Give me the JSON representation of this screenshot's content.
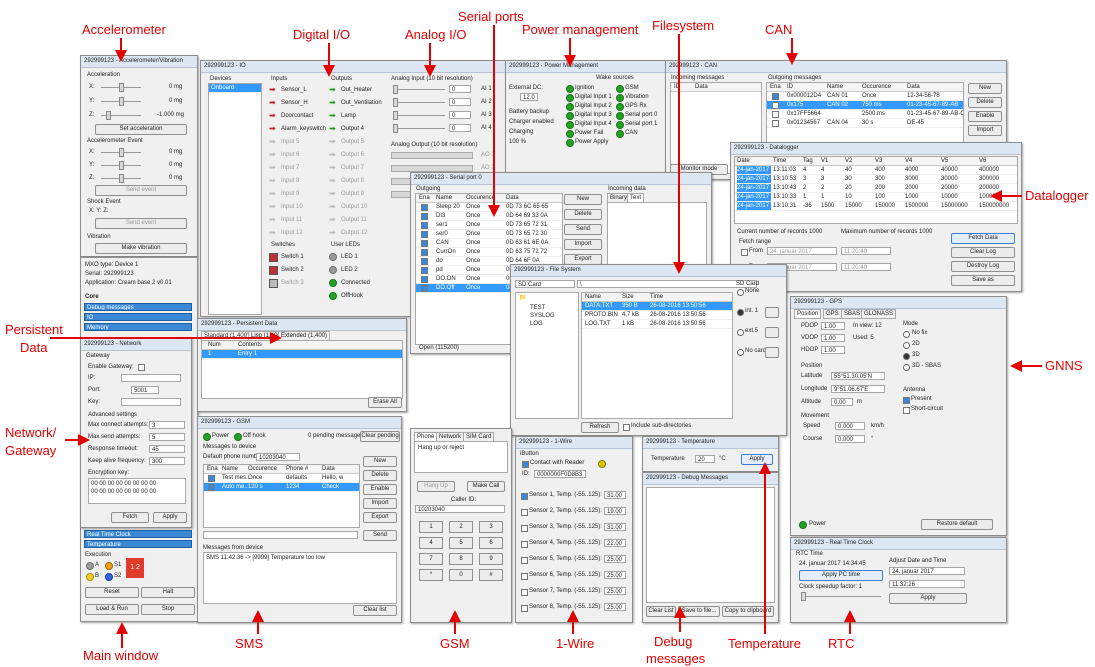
{
  "labels": {
    "accelerometer": "Accelerometer",
    "digital_io": "Digital I/O",
    "analog_io": "Analog I/O",
    "serial_ports": "Serial ports",
    "power_mgmt": "Power management",
    "filesystem": "Filesystem",
    "can": "CAN",
    "datalogger": "Datalogger",
    "persistent_l1": "Persistent",
    "persistent_l2": "Data",
    "gnns": "GNNS",
    "network_l1": "Network/",
    "network_l2": "Gateway",
    "main_window": "Main window",
    "sms": "SMS",
    "gsm": "GSM",
    "one_wire": "1-Wire",
    "debug_l1": "Debug",
    "debug_l2": "messages",
    "temperature": "Temperature",
    "rtc": "RTC"
  },
  "accel": {
    "title": "292999123 - Accelerometer/Vibration",
    "acceleration": "Acceleration",
    "x": "X:",
    "y": "Y:",
    "z": "Z:",
    "xv": "0 mg",
    "yv": "0 mg",
    "zv": "-1.000 mg",
    "set_btn": "Set acceleration",
    "event": "Accelerometer Event",
    "ex": "0 mg",
    "ey": "0 mg",
    "ez": "0 mg",
    "send_event": "Send event",
    "shock": "Shock Event",
    "shock_axes": "X:  Y:  Z:",
    "send_event2": "Send event",
    "vibration": "Vibration",
    "make_vib": "Make vibration"
  },
  "io": {
    "title": "292999123 - IO",
    "devices": "Devices",
    "onboard": "Onboard",
    "inputs": "Inputs",
    "outputs": "Outputs",
    "input_items": [
      "Sensor_L",
      "Sensor_H",
      "Doorcontact",
      "Alarm_keyswitch",
      "Input 5",
      "Input 6",
      "Input 7",
      "Input 8",
      "Input 9",
      "Input 10",
      "Input 11",
      "Input 12"
    ],
    "output_items": [
      "Out_Heater",
      "Out_Ventilation",
      "Lamp",
      "Output 4",
      "Output 5",
      "Output 6",
      "Output 7",
      "Output 8",
      "Output 9",
      "Output 10",
      "Output 11",
      "Output 12"
    ],
    "switches": "Switches",
    "switch_items": [
      "Switch 1",
      "Switch 2",
      "Switch 3"
    ],
    "user_leds": "User LEDs",
    "led_items": [
      "LED 1",
      "LED 2",
      "Connected",
      "OffHook"
    ],
    "analog_in": "Analog Input (10 bit resolution)",
    "ai_labels": [
      "AI 1",
      "AI 2",
      "AI 3",
      "AI 4"
    ],
    "ai_value": "0",
    "analog_out": "Analog Output (10 bit resolution)",
    "ao_labels": [
      "AO 1",
      "AO 2",
      "AO 3",
      "AO 4"
    ]
  },
  "power": {
    "title": "292999123 - Power Management",
    "wake": "Wake sources",
    "ext_dc": "External DC:",
    "voltage": "12.0",
    "battery": "Battery backup",
    "charger": "Charger enabled",
    "charging": "Charging",
    "pct": "100 %",
    "wake_items": [
      "Ignition",
      "Digital Input 1",
      "Digital Input 2",
      "Digital Input 3",
      "Digital Input 4",
      "Power Fail",
      "Power Apply"
    ],
    "wake_items2": [
      "GSM",
      "Vibration",
      "GPS Rx",
      "Serial port 0",
      "Serial port 1",
      "CAN"
    ]
  },
  "can": {
    "title": "292999123 - CAN",
    "incoming": "Incoming messages",
    "id": "ID",
    "data": "Data",
    "outgoing": "Outgoing messages",
    "cols": [
      "Ena",
      "ID",
      "Name",
      "Occurence",
      "Data"
    ],
    "rows": [
      [
        "0x000012D4",
        "CAN 01",
        "Once",
        "12-34-56-78"
      ],
      [
        "0x175",
        "CAN 02",
        "750 ms",
        "01-23-45-67-89-AB"
      ],
      [
        "0x17FF5664",
        "",
        "2500 ms",
        "01-23-45-67-89-AB-CD-EF"
      ],
      [
        "0x01234567",
        "CAN 04",
        "30 s",
        "DE-45"
      ]
    ],
    "btns": [
      "New",
      "Delete",
      "Enable",
      "Import"
    ],
    "monitor": "Monitor mode",
    "clear": "Clear"
  },
  "datalogger": {
    "title": "292999123 - Datalogger",
    "cols": [
      "Date",
      "Time",
      "Tag",
      "V1",
      "V2",
      "V3",
      "V4",
      "V5",
      "V6"
    ],
    "rows": [
      [
        "24-jan-2017",
        "13:11:03",
        "4",
        "4",
        "40",
        "400",
        "4000",
        "40000",
        "400000"
      ],
      [
        "24-jan-2017",
        "13:10:53",
        "3",
        "3",
        "30",
        "300",
        "3000",
        "30000",
        "300000"
      ],
      [
        "24-jan-2017",
        "13:10:43",
        "2",
        "2",
        "20",
        "200",
        "2000",
        "20000",
        "200000"
      ],
      [
        "24-jan-2017",
        "13:10:33",
        "1",
        "1",
        "10",
        "100",
        "1000",
        "10000",
        "100000"
      ],
      [
        "24-jan-2017",
        "13:10:31",
        "-36",
        "1500",
        "15000",
        "150000",
        "1500000",
        "15000000",
        "150000000"
      ]
    ],
    "current": "Current number of records",
    "cur_val": "1000",
    "max": "Maximum number of records",
    "max_val": "1000",
    "fetch_range": "Fetch range",
    "from": "From",
    "to": "To",
    "date": "24.  januar  2017",
    "time": "11:20:40",
    "btns": [
      "Fetch Data",
      "Clear Log",
      "Destroy Log",
      "Save as"
    ]
  },
  "serial": {
    "title": "292999123 - Serial port 0",
    "outgoing": "Outgoing",
    "cols": [
      "Ena",
      "Name",
      "Occurence",
      "Data"
    ],
    "rows": [
      [
        "Sleep 20",
        "Once",
        "0D 73 6C 65 65"
      ],
      [
        "DI3",
        "Once",
        "0D 64 69 33 0A"
      ],
      [
        "ser1",
        "Once",
        "0D 73 65 72 31"
      ],
      [
        "ser0",
        "Once",
        "0D 73 65 72 30"
      ],
      [
        "CAN",
        "Once",
        "0D 63 61 6E 0A"
      ],
      [
        "CurrOn",
        "Once",
        "0D 63 75 72 72"
      ],
      [
        "do",
        "Once",
        "0D 64 6F 0A"
      ],
      [
        "pd",
        "Once",
        "0D 70 64 0A"
      ],
      [
        "DO.ON",
        "Once",
        "0D 64 6F 2E 6F"
      ],
      [
        "DO.Off",
        "Once",
        "0D 64 6F 2E 6F"
      ]
    ],
    "btns": [
      "New",
      "Delete",
      "Send",
      "Import",
      "Export"
    ],
    "incoming": "Incoming data",
    "tab_bin": "Binary",
    "tab_text": "Text",
    "status": "Open (115200)"
  },
  "fs": {
    "title": "292999123 - File System",
    "drive": "SD Card",
    "path": "\\",
    "tree": [
      "TEST",
      "SYSLOG",
      "LOG"
    ],
    "cols": [
      "Name",
      "Size",
      "Time"
    ],
    "rows": [
      [
        "DATA.TXT",
        "350 B",
        "26-08-2016 13:50:56"
      ],
      [
        "PROTO.BIN",
        "4,7 kB",
        "26-08-2016 13:50:56"
      ],
      [
        "LOG.TXT",
        "1 kB",
        "26-08-2016 13:50:56"
      ]
    ],
    "sdcard": "SD Card",
    "radios": [
      "None",
      "int. 1",
      "ext.5",
      "No card"
    ],
    "refresh": "Refresh",
    "include": "Include sub-directories"
  },
  "persist": {
    "title": "292999123 - Persistent Data",
    "tabs": [
      "Standard (1,400)",
      "Lisp (1,400)",
      "Extended (1,400)"
    ],
    "num": "Num",
    "contents": "Contents",
    "row_num": "1",
    "row_val": "Entry 1",
    "erase": "Erase All"
  },
  "gnss": {
    "title": "292999123 - GPS",
    "tabs": [
      "Position",
      "GPS",
      "SBAS",
      "GLONASS"
    ],
    "pdop": "PDOP",
    "pdop_v": "1.00",
    "vdop": "VDOP",
    "vdop_v": "1.00",
    "hdop": "HDOP",
    "hdop_v": "1.00",
    "inview": "In view:",
    "inview_v": "12",
    "used": "Used:",
    "used_v": "5",
    "position": "Position",
    "lat": "Latitude",
    "lat_v": "55°51.30.05'N",
    "lon": "Longitude",
    "lon_v": "9°51.06.67'E",
    "alt": "Altitude",
    "alt_v": "0.00",
    "alt_u": "m",
    "movement": "Movement",
    "speed": "Speed",
    "speed_v": "0.000",
    "speed_u": "km/h",
    "course": "Course",
    "course_v": "0.000",
    "course_u": "°",
    "mode": "Mode",
    "modes": [
      "No fix",
      "2D",
      "3D",
      "3D - SBAS"
    ],
    "antenna": "Antenna",
    "ant": [
      "Present",
      "Short-circuit"
    ],
    "power": "Power",
    "restore": "Restore default"
  },
  "net": {
    "title": "292999123 - Network",
    "gateway": "Gateway",
    "enable": "Enable Gateway:",
    "ip": "IP:",
    "port": "Port:",
    "port_v": "5001",
    "key": "Key:",
    "adv": "Advanced settings",
    "maxconn": "Max connect attempts:",
    "maxconn_v": "3",
    "maxsend": "Max send attempts:",
    "maxsend_v": "5",
    "resp": "Response timeout:",
    "resp_v": "45",
    "keepalive": "Keep alive frequency:",
    "keepalive_v": "300",
    "enc": "Encryption key:",
    "enc_v1": "00 00 00 00 00 00 00 00",
    "enc_v2": "00 00 00 00 00 00 00 00",
    "fetch": "Fetch",
    "apply": "Apply"
  },
  "main": {
    "mxo_type": "MXO type:",
    "mxo_type_v": "Device 1",
    "serial": "Serial:",
    "serial_v": "292999123",
    "app": "Application:",
    "app_v": "Cream base 2 v0.01",
    "core": "Core",
    "core_items": [
      "Debug messages",
      "IO",
      "Memory"
    ],
    "extra_items": [
      "Real Time Clock",
      "Temperature"
    ],
    "execution": "Execution",
    "a": "A",
    "s1": "S1",
    "b": "B",
    "s2": "S2",
    "digits": "1 2",
    "reset": "Reset",
    "halt": "Halt",
    "loadrun": "Load & Run",
    "stop": "Stop"
  },
  "gsm": {
    "title": "292999123 - GSM",
    "power": "Power",
    "offhook": "Off hook",
    "pending": "0 pending messages",
    "clear_pending": "Clear pending",
    "to_device": "Messages to device",
    "default_phone": "Default phone number:",
    "phone_v": "10203040",
    "cols": [
      "Ena",
      "Name",
      "Occurence",
      "Phone #",
      "Data"
    ],
    "rows": [
      [
        "Test mes..",
        "Once",
        "defaults",
        "Hello, w"
      ],
      [
        "Auto me..",
        "120 s",
        "1234",
        "Check"
      ]
    ],
    "btns": [
      "New",
      "Delete",
      "Enable",
      "Import",
      "Export"
    ],
    "send": "Send",
    "from_device": "Messages from device",
    "sms_msg": "SMS 11:42:36 -> [9999] Temperature too low",
    "clear_list": "Clear list"
  },
  "phone": {
    "tabs": [
      "Phone",
      "Network",
      "SIM Card"
    ],
    "hangup_reject": "Hang up or reject",
    "hangup": "Hang Up",
    "makecall": "Make Call",
    "callerid": "Caller ID:",
    "callerid_v": "10203040",
    "keys": [
      "1",
      "2",
      "3",
      "4",
      "5",
      "6",
      "7",
      "8",
      "9",
      "*",
      "0",
      "#"
    ]
  },
  "onewire": {
    "title": "292999123 - 1-Wire",
    "ibutton": "iButton",
    "contact": "Contact with Reader",
    "id": "ID:",
    "id_v": "0000000F0D8B3",
    "sensors": [
      "Sensor 1, Temp. (-55..125):",
      "Sensor 2, Temp. (-55..125):",
      "Sensor 3, Temp. (-55..125):",
      "Sensor 4, Temp. (-55..125):",
      "Sensor 5, Temp. (-55..125):",
      "Sensor 6, Temp. (-55..125):",
      "Sensor 7, Temp. (-55..125):",
      "Sensor 8, Temp. (-55..125):"
    ],
    "values": [
      "31.00",
      "19.00",
      "31.00",
      "22.00",
      "25.00",
      "25.00",
      "25.00",
      "25.00"
    ]
  },
  "temp": {
    "title": "292999123 - Temperature",
    "label": "Temperature",
    "value": "20",
    "unit": "°C",
    "apply": "Apply"
  },
  "debug": {
    "title": "292999123 - Debug Messages",
    "btns": [
      "Clear List",
      "Save to file...",
      "Copy to clipboard"
    ]
  },
  "rtc": {
    "title": "292999123 - Real Time Clock",
    "rtc_time": "RTC Time",
    "now": "24. januar 2017 14:34:45",
    "apply_pc": "Apply PC time",
    "speedup": "Clock speedup factor: 1",
    "adjust": "Adjust Date and Time",
    "date_v": "24.  januar   2017",
    "time_v": "11:32:26",
    "apply": "Apply"
  }
}
